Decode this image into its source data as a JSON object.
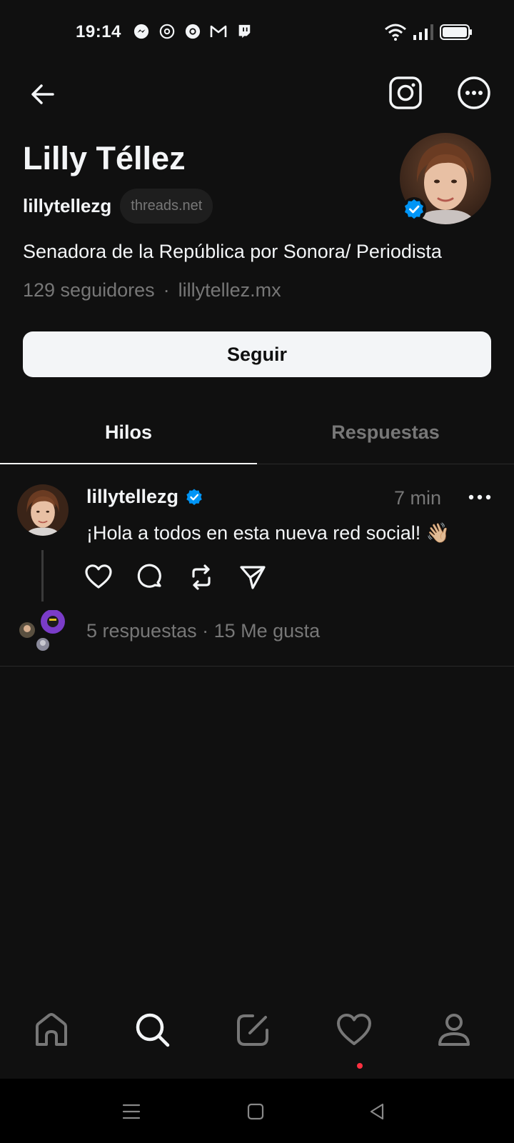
{
  "status_bar": {
    "time": "19:14",
    "notification_icons": [
      "messenger-icon",
      "threads-icon",
      "chrome-icon",
      "gmail-icon",
      "twitch-icon"
    ],
    "system_icons": [
      "wifi-icon",
      "signal-icon",
      "battery-icon"
    ]
  },
  "profile": {
    "name": "Lilly Téllez",
    "handle": "lillytellezg",
    "domain_pill": "threads.net",
    "bio": "Senadora de la República por Sonora/ Periodista",
    "followers": "129 seguidores",
    "separator": "·",
    "website": "lillytellez.mx",
    "verified": true,
    "follow_label": "Seguir"
  },
  "tabs": [
    {
      "label": "Hilos",
      "active": true
    },
    {
      "label": "Respuestas",
      "active": false
    }
  ],
  "post": {
    "author": "lillytellezg",
    "time": "7 min",
    "text": "¡Hola a todos en esta nueva red social! 👋🏼",
    "stats": "5 respuestas · 15 Me gusta"
  },
  "bottom_nav": [
    "home-icon",
    "search-icon",
    "compose-icon",
    "activity-heart-icon",
    "profile-icon"
  ],
  "colors": {
    "background": "#101010",
    "text_primary": "#f3f5f7",
    "text_secondary": "#777777",
    "verified_blue": "#0095f6",
    "notification_dot": "#ff3040"
  }
}
